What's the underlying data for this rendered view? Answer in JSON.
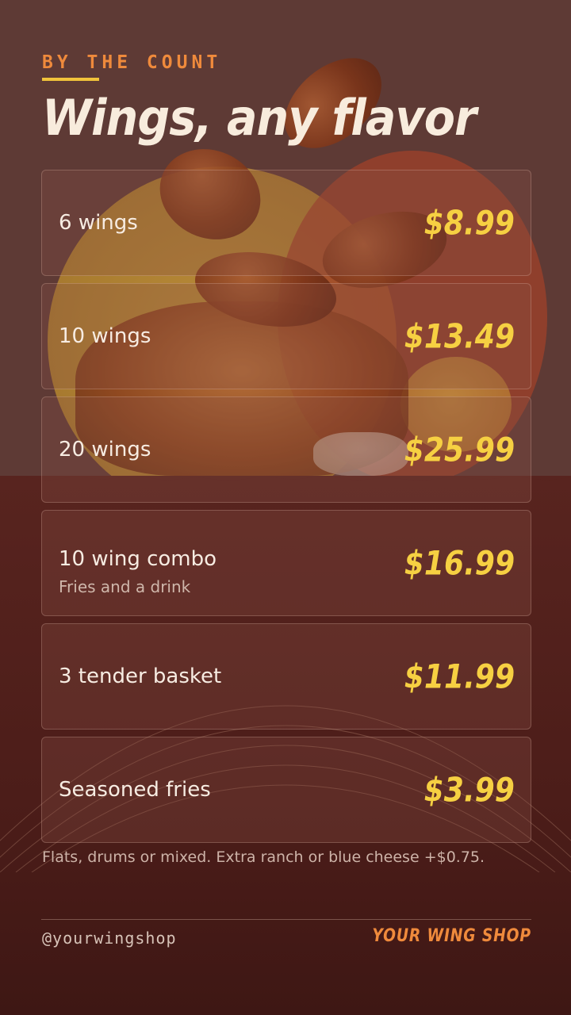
{
  "header": {
    "eyebrow": "BY THE COUNT",
    "title": "Wings, any flavor"
  },
  "menu": {
    "items": [
      {
        "name": "6 wings",
        "sub": "",
        "price": "$8.99"
      },
      {
        "name": "10 wings",
        "sub": "",
        "price": "$13.49"
      },
      {
        "name": "20 wings",
        "sub": "",
        "price": "$25.99"
      },
      {
        "name": "10 wing combo",
        "sub": "Fries and a drink",
        "price": "$16.99"
      },
      {
        "name": "3 tender basket",
        "sub": "",
        "price": "$11.99"
      },
      {
        "name": "Seasoned fries",
        "sub": "",
        "price": "$3.99"
      }
    ]
  },
  "footnote": "Flats, drums or mixed. Extra ranch or blue cheese +$0.75.",
  "footer": {
    "handle": "@yourwingshop",
    "brand": "YOUR WING SHOP"
  },
  "colors": {
    "accent_orange": "#ef8a3c",
    "price_yellow": "#f6d042",
    "background": "#5a3530"
  }
}
